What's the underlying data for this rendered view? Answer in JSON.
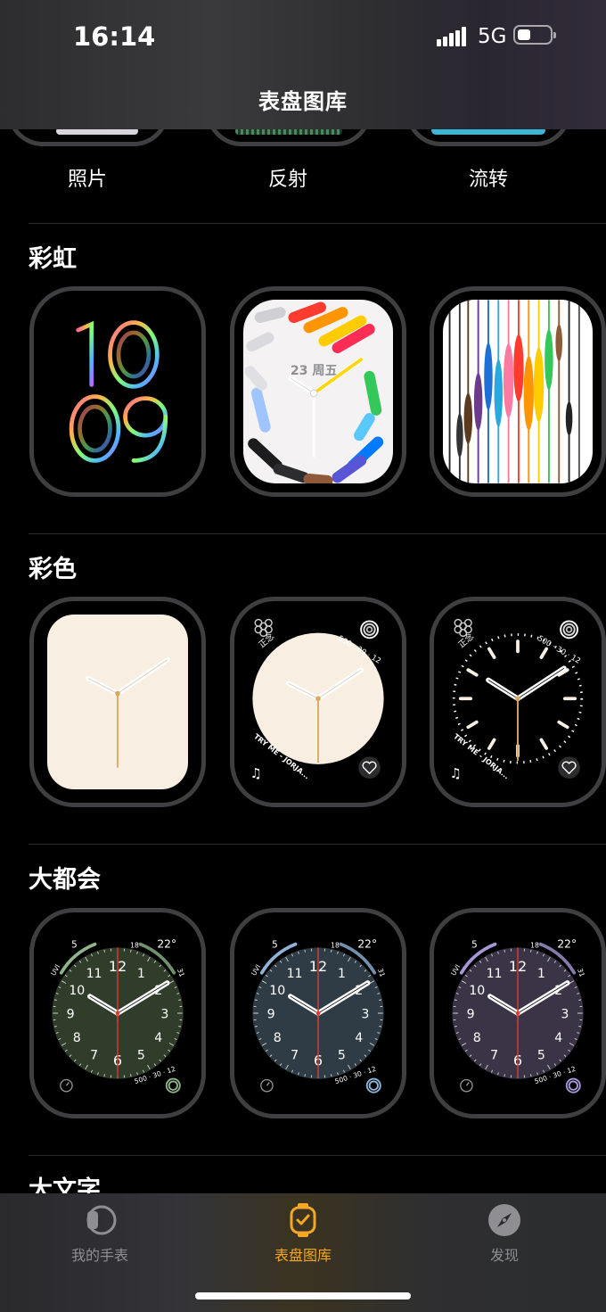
{
  "status": {
    "time": "16:14",
    "network": "5G"
  },
  "header": {
    "title": "表盘图库"
  },
  "top_row": {
    "captions": [
      "照片",
      "反射",
      "流转"
    ]
  },
  "sections": [
    {
      "title": "彩虹",
      "faces": [
        {
          "time": "10 09"
        },
        {
          "date": "23 周五"
        },
        {}
      ]
    },
    {
      "title": "彩色",
      "faces": [
        {},
        {
          "left_top": "正念",
          "count": "500 · 30 · 12",
          "music": "TRY ME - JORJA..."
        },
        {
          "left_top": "正念",
          "count": "500 · 30 · 12",
          "music": "TRY ME - JORJA..."
        }
      ]
    },
    {
      "title": "大都会",
      "faces": [
        {
          "uvi": "UVI",
          "uv_val": "5",
          "temp": "22°",
          "low": "18",
          "high": "31",
          "count": "500 · 30 · 12",
          "tint": "#2f3d2a",
          "ring": "#8fb38a"
        },
        {
          "uvi": "UVI",
          "uv_val": "5",
          "temp": "22°",
          "low": "18",
          "high": "31",
          "count": "500 · 30 · 12",
          "tint": "#2f3c45",
          "ring": "#8fb3d6"
        },
        {
          "uvi": "UVI",
          "uv_val": "5",
          "temp": "22°",
          "low": "18",
          "high": "31",
          "count": "500 · 30 · 12",
          "tint": "#3a3446",
          "ring": "#a897d6"
        }
      ]
    },
    {
      "title": "大文字"
    }
  ],
  "tabbar": {
    "tabs": [
      {
        "label": "我的手表",
        "icon": "watch-icon"
      },
      {
        "label": "表盘图库",
        "icon": "watch-face-icon",
        "active": true
      },
      {
        "label": "发现",
        "icon": "compass-icon"
      }
    ],
    "accent": "#f5a623"
  }
}
